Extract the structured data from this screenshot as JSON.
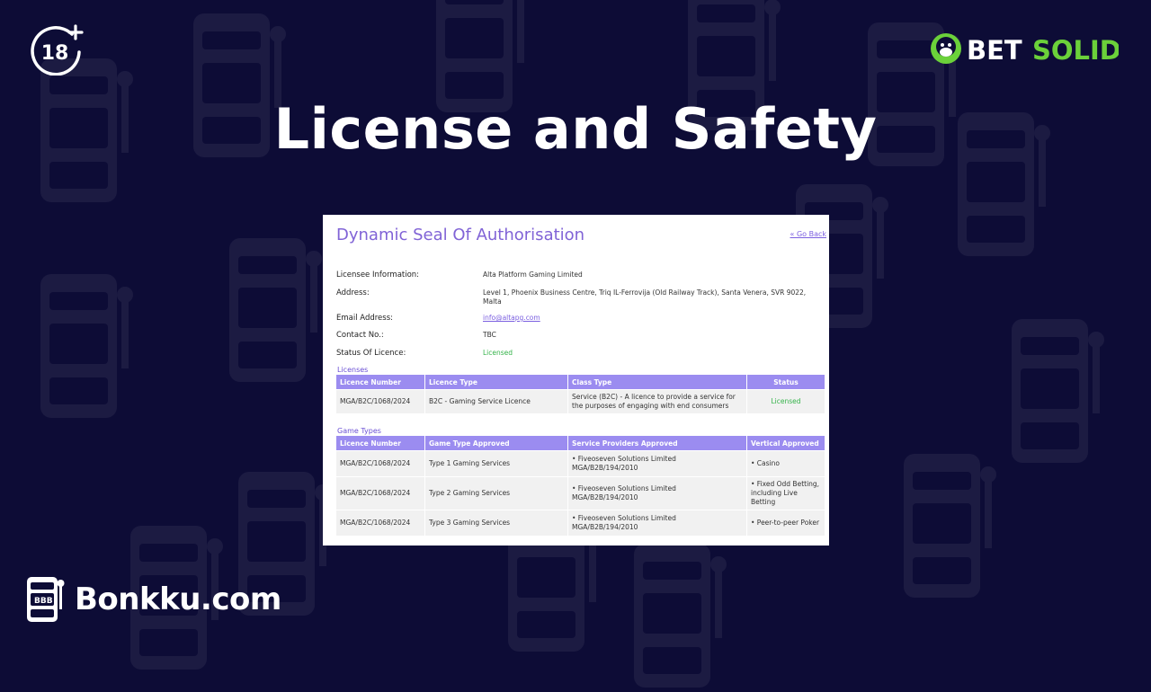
{
  "hero": {
    "title": "License and Safety"
  },
  "badges": {
    "age_limit": "18"
  },
  "brand": {
    "name_part1": "BET",
    "name_part2": "SOLID",
    "accent": "#6bd13a"
  },
  "card": {
    "title": "Dynamic Seal Of Authorisation",
    "go_back": "« Go Back",
    "info": [
      {
        "label": "Licensee Information:",
        "value": "Alta Platform Gaming Limited",
        "kind": "text"
      },
      {
        "label": "Address:",
        "value": "Level 1, Phoenix Business Centre, Triq IL-Ferrovija (Old Railway Track), Santa Venera, SVR 9022, Malta",
        "kind": "text"
      },
      {
        "label": "Email Address:",
        "value": "info@altapg.com",
        "kind": "link"
      },
      {
        "label": "Contact No.:",
        "value": "TBC",
        "kind": "text"
      },
      {
        "label": "Status Of Licence:",
        "value": "Licensed",
        "kind": "status"
      }
    ],
    "licenses": {
      "label": "Licenses",
      "headers": [
        "Licence Number",
        "Licence Type",
        "Class Type",
        "Status"
      ],
      "rows": [
        [
          "MGA/B2C/1068/2024",
          "B2C - Gaming Service Licence",
          "Service (B2C) - A licence to provide a service for the purposes of engaging with end consumers",
          "Licensed"
        ]
      ]
    },
    "game_types": {
      "label": "Game Types",
      "headers": [
        "Licence Number",
        "Game Type Approved",
        "Service Providers Approved",
        "Vertical Approved"
      ],
      "rows": [
        [
          "MGA/B2C/1068/2024",
          "Type 1 Gaming Services",
          "• Fiveoseven Solutions Limited MGA/B2B/194/2010",
          "• Casino"
        ],
        [
          "MGA/B2C/1068/2024",
          "Type 2 Gaming Services",
          "• Fiveoseven Solutions Limited MGA/B2B/194/2010",
          "• Fixed Odd Betting, including Live Betting"
        ],
        [
          "MGA/B2C/1068/2024",
          "Type 3 Gaming Services",
          "• Fiveoseven Solutions Limited MGA/B2B/194/2010",
          "• Peer-to-peer Poker"
        ]
      ]
    }
  },
  "footer": {
    "site_name": "Bonkku.com"
  },
  "colors": {
    "background": "#0d0c36",
    "card_title": "#8063d6",
    "table_header": "#9b8cf0",
    "licensed": "#35b34a"
  }
}
